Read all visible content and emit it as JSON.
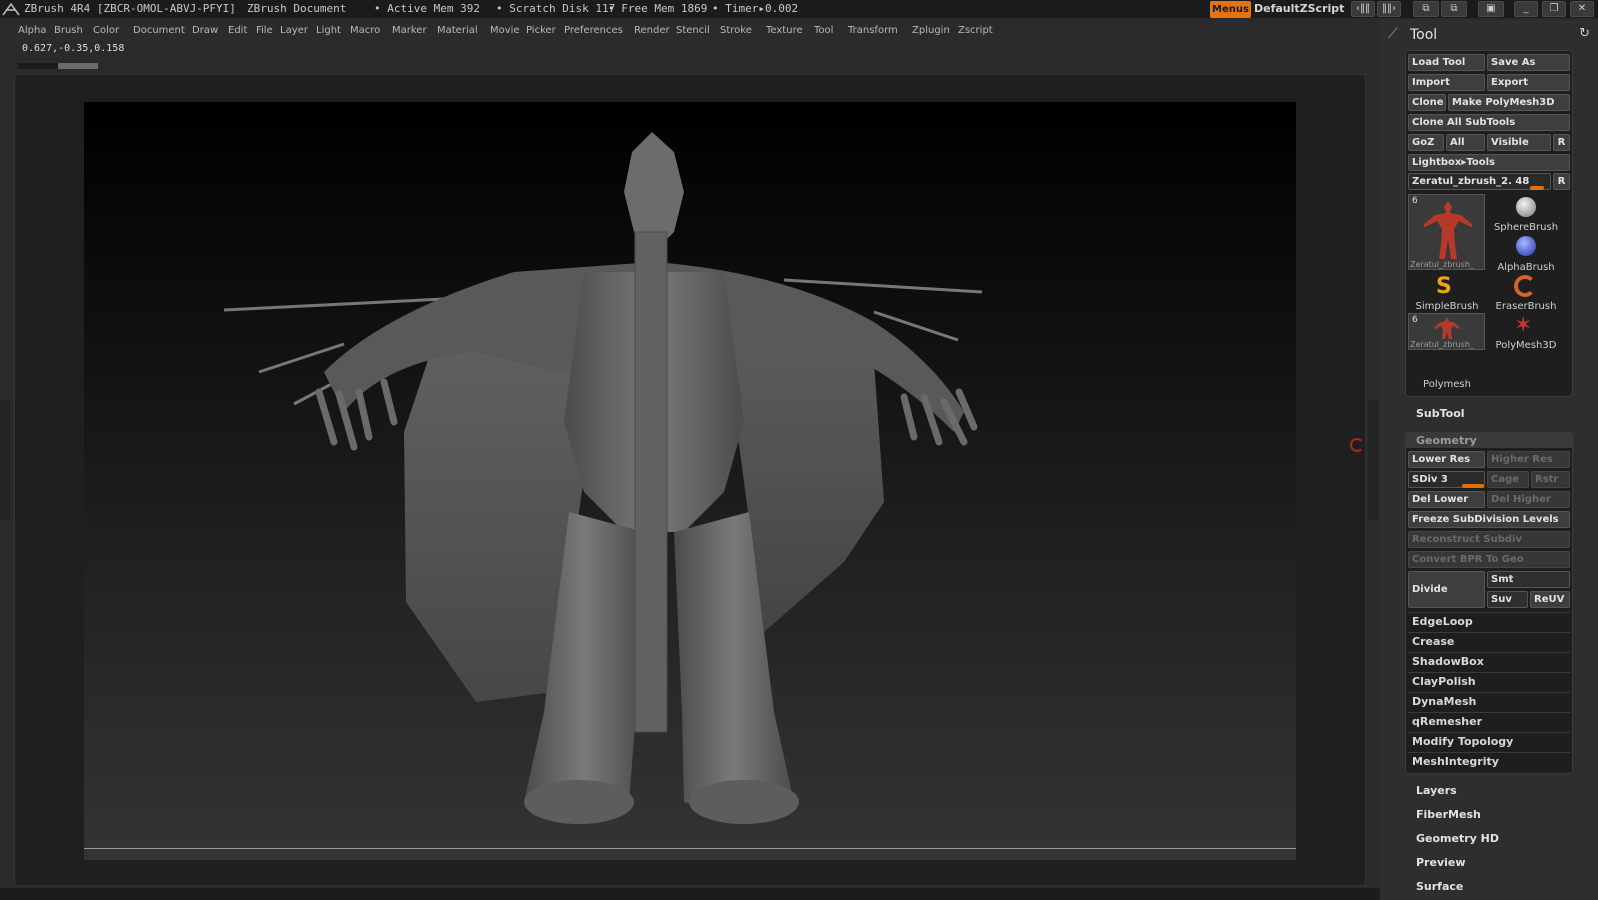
{
  "titlebar": {
    "app": "ZBrush 4R4 [ZBCR-OMOL-ABVJ-PFYI]",
    "document": "ZBrush Document",
    "active_mem": "• Active Mem 392",
    "scratch": "• Scratch Disk 117",
    "free_mem": "• Free Mem 1869",
    "timer": "• Timer▸0.002",
    "menus": "Menus",
    "script": "DefaultZScript"
  },
  "menubar": [
    "Alpha",
    "Brush",
    "Color",
    "Document",
    "Draw",
    "Edit",
    "File",
    "Layer",
    "Light",
    "Macro",
    "Marker",
    "Material",
    "Movie",
    "Picker",
    "Preferences",
    "Render",
    "Stencil",
    "Stroke",
    "Texture",
    "Tool",
    "Transform",
    "Zplugin",
    "Zscript"
  ],
  "coords": "0.627,-0.35,0.158",
  "tool": {
    "title": "Tool",
    "load": "Load Tool",
    "save_as": "Save As",
    "import": "Import",
    "export": "Export",
    "clone": "Clone",
    "make_polymesh": "Make PolyMesh3D",
    "clone_all": "Clone All SubTools",
    "goz": "GoZ",
    "all": "All",
    "visible": "Visible",
    "r": "R",
    "lightbox": "Lightbox▸Tools",
    "current": "Zeratul_zbrush_2. 48",
    "thumb_count": "6",
    "thumb_cap": "Zeratul_zbrush_",
    "brushes": [
      "SphereBrush",
      "AlphaBrush",
      "SimpleBrush",
      "EraserBrush",
      "PolyMesh3D"
    ],
    "thumb2_count": "6",
    "thumb2_cap": "Zeratul_zbrush_",
    "polymesh": "Polymesh"
  },
  "subtool": "SubTool",
  "geometry": {
    "title": "Geometry",
    "lower_res": "Lower Res",
    "higher_res": "Higher Res",
    "sdiv": "SDiv 3",
    "cage": "Cage",
    "rstr": "Rstr",
    "del_lower": "Del Lower",
    "del_higher": "Del Higher",
    "freeze": "Freeze SubDivision Levels",
    "reconstruct": "Reconstruct Subdiv",
    "convert": "Convert BPR To Geo",
    "divide": "Divide",
    "smt": "Smt",
    "suv": "Suv",
    "reuv": "ReUV",
    "items": [
      "EdgeLoop",
      "Crease",
      "ShadowBox",
      "ClayPolish",
      "DynaMesh",
      "qRemesher",
      "Modify Topology",
      "MeshIntegrity"
    ]
  },
  "sections": [
    "Layers",
    "FiberMesh",
    "Geometry HD",
    "Preview",
    "Surface"
  ],
  "colors": {
    "accent": "#e57314",
    "panel": "#2e2e2e",
    "canvas": "#000000"
  }
}
